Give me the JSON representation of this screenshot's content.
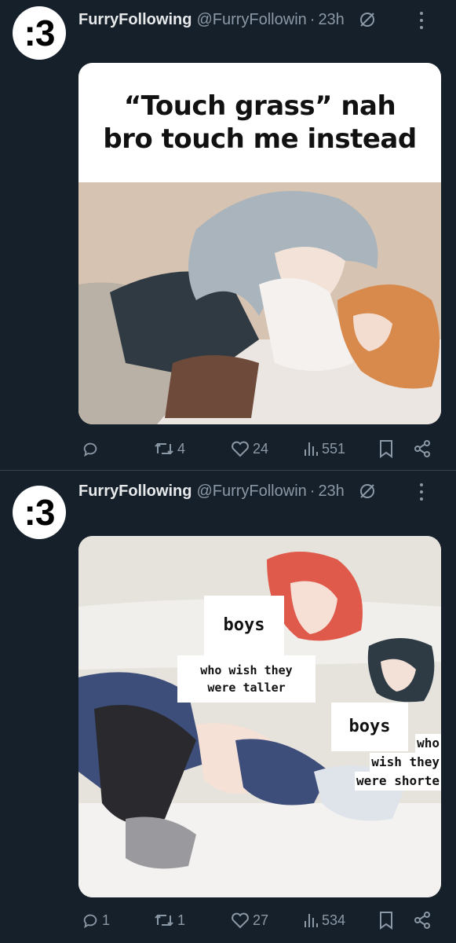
{
  "tweets": [
    {
      "avatar_text": ":3",
      "display_name": "FurryFollowing",
      "handle": "@FurryFollowin",
      "separator": "·",
      "time": "23h",
      "meme_caption": [
        "“Touch grass” nah",
        "bro touch me instead"
      ],
      "reply_count": "",
      "retweet_count": "4",
      "like_count": "24",
      "view_count": "551"
    },
    {
      "avatar_text": ":3",
      "display_name": "FurryFollowing",
      "handle": "@FurryFollowin",
      "separator": "·",
      "time": "23h",
      "meme_labels": {
        "boys_1": "boys",
        "who_1": "who wish they",
        "who_1b": "were taller",
        "boys_2": "boys",
        "who_2a": "who",
        "who_2b": "wish they",
        "who_2c": "were shorte"
      },
      "reply_count": "1",
      "retweet_count": "1",
      "like_count": "27",
      "view_count": "534"
    }
  ],
  "icons": {
    "reply": "reply-icon",
    "retweet": "retweet-icon",
    "like": "heart-icon",
    "views": "views-icon",
    "bookmark": "bookmark-icon",
    "share": "share-icon",
    "grok": "grok-icon",
    "more": "more-icon"
  },
  "colors": {
    "background": "#15202b",
    "muted": "#8b98a5",
    "divider": "#38444d"
  }
}
